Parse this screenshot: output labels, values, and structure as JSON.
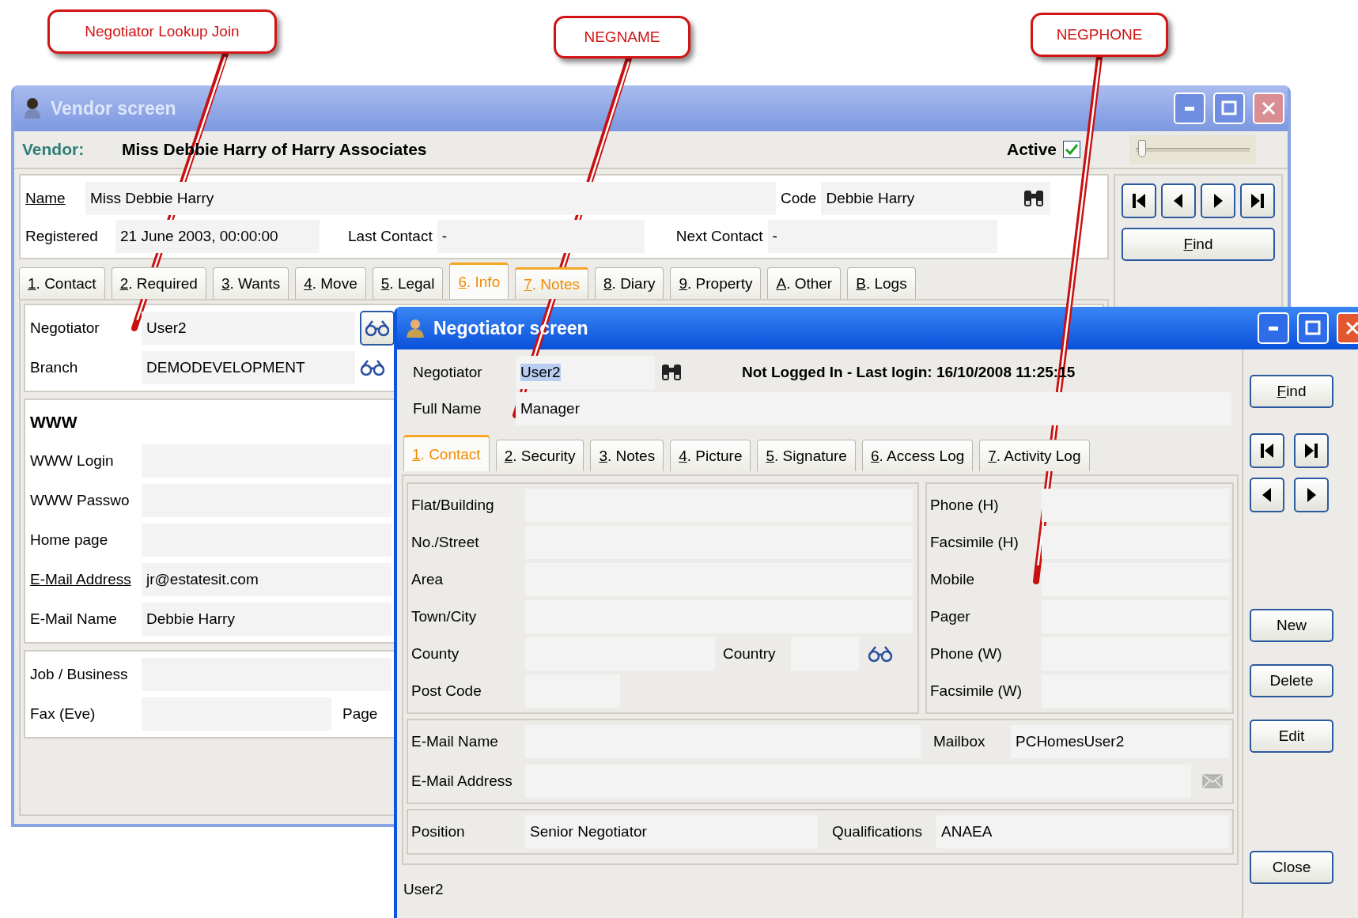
{
  "callouts": [
    {
      "text": "Negotiator Lookup Join"
    },
    {
      "text": "NEGNAME"
    },
    {
      "text": "NEGPHONE"
    }
  ],
  "vendor_window": {
    "title": "Vendor screen",
    "header": {
      "label": "Vendor:",
      "value": "Miss Debbie Harry of Harry Associates"
    },
    "active": {
      "label": "Active",
      "checked": true
    },
    "slider": {
      "level": 0.02
    },
    "name": {
      "label": "Name",
      "value": "Miss Debbie Harry"
    },
    "code": {
      "label": "Code",
      "value": "Debbie Harry"
    },
    "registered": {
      "label": "Registered",
      "value": "21 June 2003, 00:00:00"
    },
    "last_contact": {
      "label": "Last Contact",
      "value": "-"
    },
    "next_contact": {
      "label": "Next Contact",
      "value": "-"
    },
    "find_button": "Find",
    "tabs": [
      {
        "label": "1. Contact",
        "selected": false,
        "highlighted": false
      },
      {
        "label": "2. Required",
        "selected": false,
        "highlighted": false
      },
      {
        "label": "3. Wants",
        "selected": false,
        "highlighted": false
      },
      {
        "label": "4. Move",
        "selected": false,
        "highlighted": false
      },
      {
        "label": "5. Legal",
        "selected": false,
        "highlighted": false
      },
      {
        "label": "6. Info",
        "selected": true,
        "highlighted": true
      },
      {
        "label": "7. Notes",
        "selected": false,
        "highlighted": true
      },
      {
        "label": "8. Diary",
        "selected": false,
        "highlighted": false
      },
      {
        "label": "9. Property",
        "selected": false,
        "highlighted": false
      },
      {
        "label": "A. Other",
        "selected": false,
        "highlighted": false
      },
      {
        "label": "B. Logs",
        "selected": false,
        "highlighted": false
      }
    ],
    "negotiator_section": [
      {
        "label": "Negotiator",
        "value": "User2",
        "kind": "button"
      },
      {
        "label": "Branch",
        "value": "DEMODEVELOPMENT",
        "kind": "icon"
      }
    ],
    "www_section": {
      "heading": "WWW",
      "rows": [
        {
          "label": "WWW Login",
          "underlined": false
        },
        {
          "label": "WWW Passwo",
          "underlined": false
        },
        {
          "label": "Home page",
          "underlined": false
        },
        {
          "label": "E-Mail Address",
          "value": "jr@estatesit.com",
          "underlined": true
        },
        {
          "label": "E-Mail Name",
          "value": "Debbie Harry",
          "underlined": false
        }
      ]
    },
    "business_section": [
      {
        "label": "Job / Business"
      },
      {
        "label": "Fax (Eve)",
        "extra_label": "Page"
      }
    ]
  },
  "negotiator_window": {
    "title": "Negotiator screen",
    "negotiator": {
      "label": "Negotiator",
      "value": "User2",
      "highlighted": true
    },
    "status": "Not Logged In - Last login: 16/10/2008 11:25:15",
    "full_name": {
      "label": "Full Name",
      "value": "Manager"
    },
    "tabs": [
      {
        "label": "1. Contact",
        "selected": true
      },
      {
        "label": "2. Security",
        "selected": false
      },
      {
        "label": "3. Notes",
        "selected": false
      },
      {
        "label": "4. Picture",
        "selected": false
      },
      {
        "label": "5. Signature",
        "selected": false
      },
      {
        "label": "6. Access Log",
        "selected": false
      },
      {
        "label": "7. Activity Log",
        "selected": false
      }
    ],
    "address": [
      {
        "label": "Flat/Building",
        "kind": "wide"
      },
      {
        "label": "No./Street",
        "kind": "wide"
      },
      {
        "label": "Area",
        "kind": "wide"
      },
      {
        "label": "Town/City",
        "kind": "wide"
      },
      {
        "label": "County",
        "kind": "pair",
        "label2": "Country"
      },
      {
        "label": "Post Code",
        "kind": "short"
      }
    ],
    "phones": [
      {
        "label": "Phone (H)"
      },
      {
        "label": "Facsimile (H)"
      },
      {
        "label": "Mobile"
      },
      {
        "label": "Pager"
      },
      {
        "label": "Phone (W)"
      },
      {
        "label": "Facsimile (W)"
      }
    ],
    "email": {
      "name_label": "E-Mail Name",
      "mailbox_label": "Mailbox",
      "mailbox": "PCHomesUser2",
      "address_label": "E-Mail Address"
    },
    "position": {
      "label": "Position",
      "value": "Senior Negotiator",
      "qual_label": "Qualifications",
      "qual": "ANAEA"
    },
    "status_bar": "User2",
    "buttons": {
      "find": "Find",
      "new": "New",
      "delete": "Delete",
      "edit": "Edit",
      "close": "Close"
    }
  }
}
